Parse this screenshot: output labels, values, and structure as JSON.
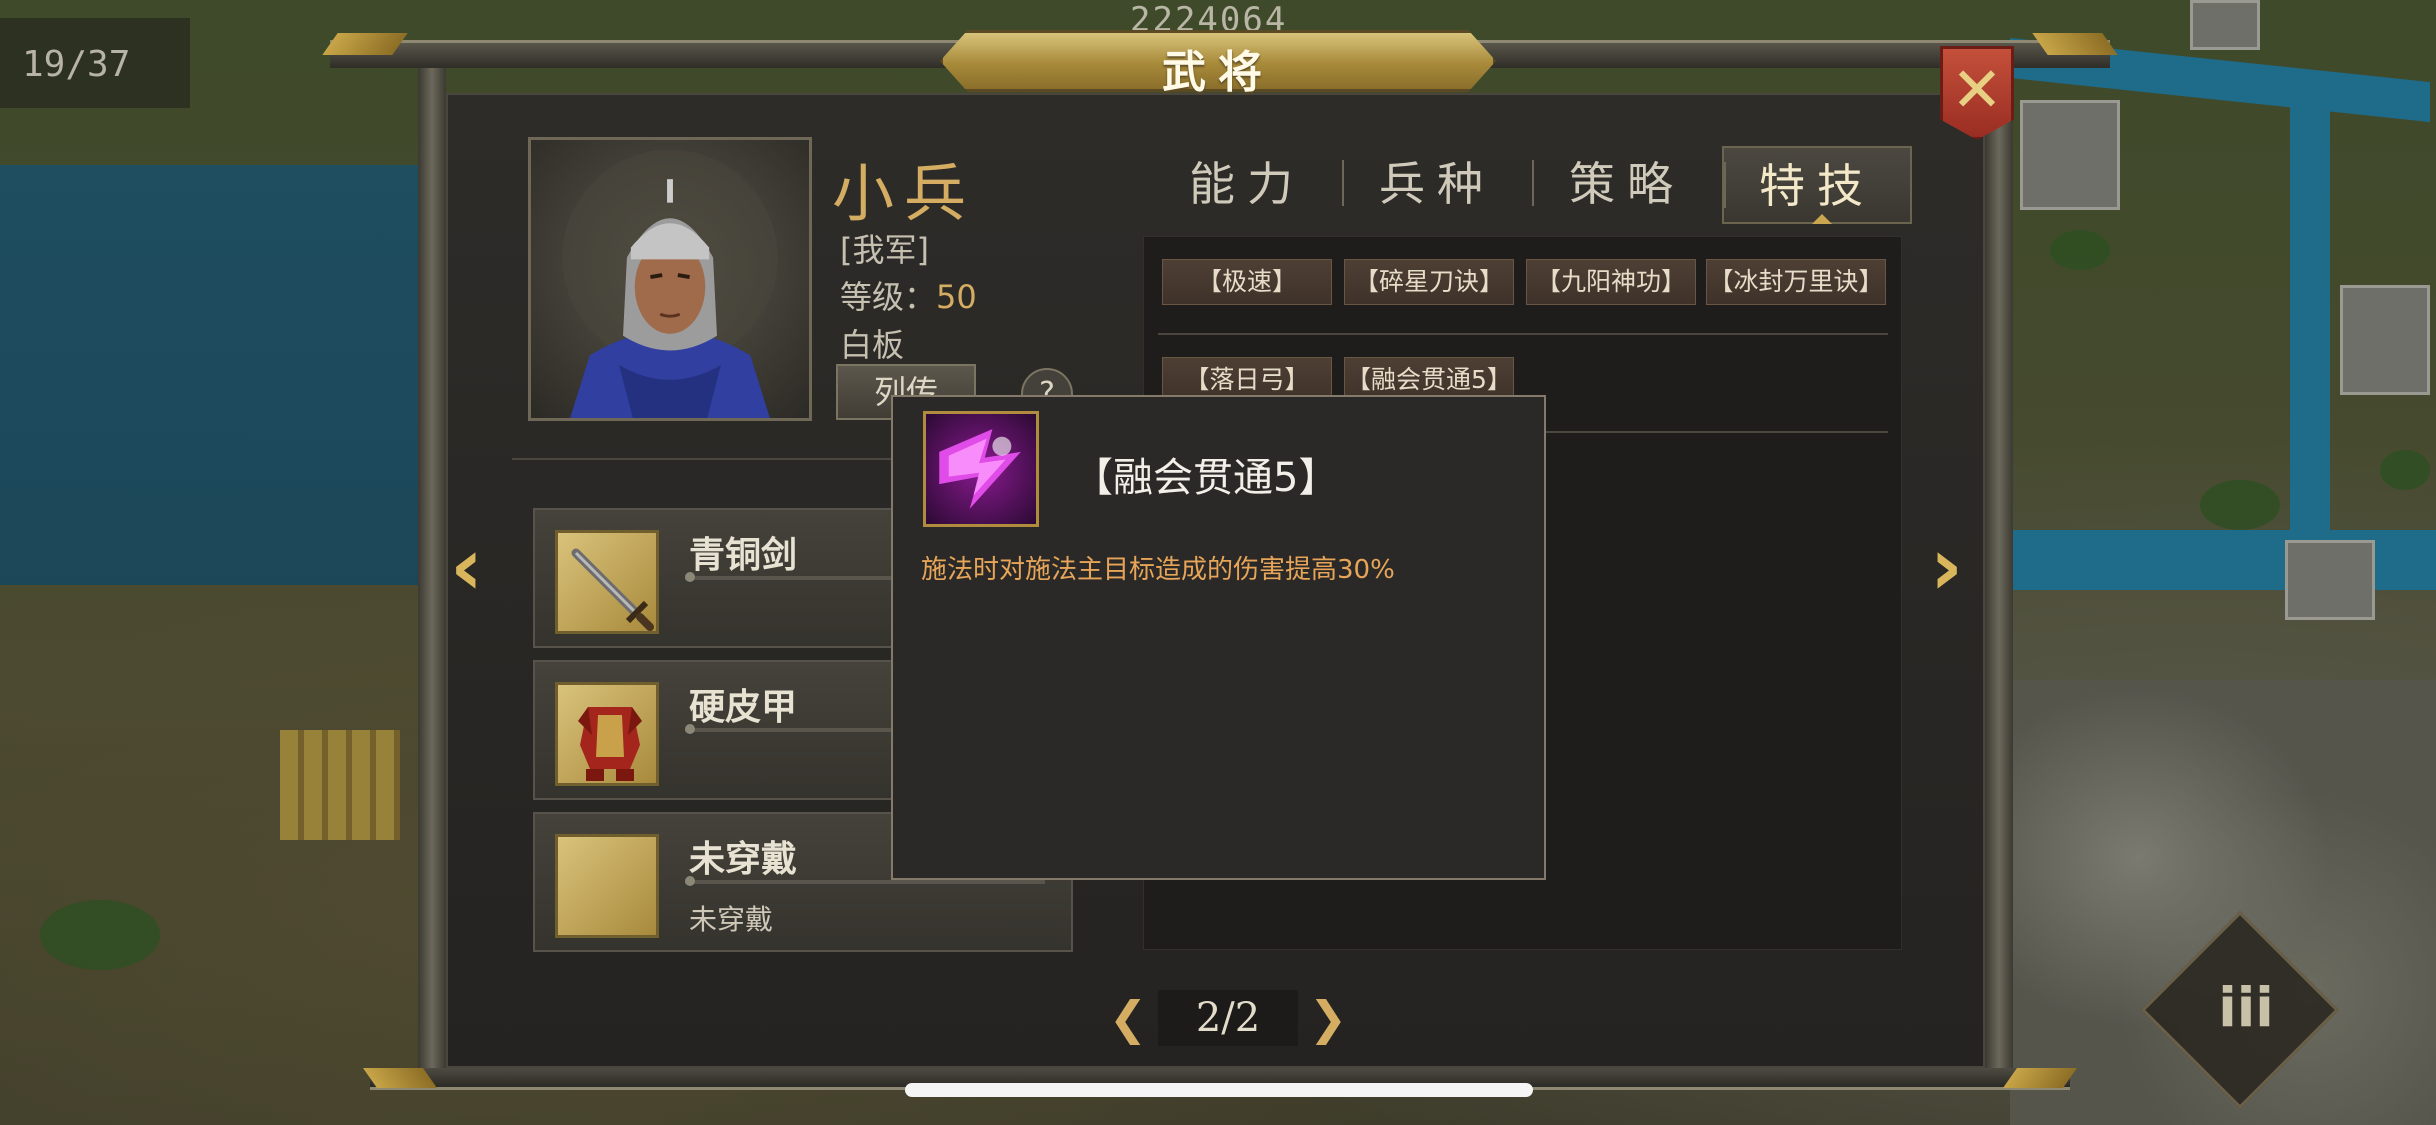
{
  "hud": {
    "page_count": "19/37",
    "top_counter": "2224064",
    "menu_glyph": "iii"
  },
  "window": {
    "title": "武将",
    "close_glyph": "✕"
  },
  "general": {
    "name": "小兵",
    "faction": "[我军]",
    "level_label": "等级：",
    "level_value": "50",
    "note": "白板",
    "bio_button": "列传",
    "help_glyph": "?"
  },
  "tabs": [
    {
      "label": "能力",
      "active": false
    },
    {
      "label": "兵种",
      "active": false
    },
    {
      "label": "策略",
      "active": false
    },
    {
      "label": "特技",
      "active": true
    }
  ],
  "skills_row1": [
    "【极速】",
    "【碎星刀诀】",
    "【九阳神功】",
    "【冰封万里诀】"
  ],
  "skills_row2": [
    "【落日弓】",
    "【融会贯通5】"
  ],
  "equipment": [
    {
      "name": "青铜剑",
      "sub": "",
      "icon": "sword-icon"
    },
    {
      "name": "硬皮甲",
      "sub": "",
      "icon": "armor-icon"
    },
    {
      "name": "未穿戴",
      "sub": "未穿戴",
      "icon": "empty-slot"
    }
  ],
  "nav": {
    "prev": "‹",
    "next": "›",
    "page": "2/2",
    "page_prev": "❮",
    "page_next": "❯"
  },
  "tooltip": {
    "title": "【融会贯通5】",
    "description": "施法时对施法主目标造成的伤害提高30%",
    "icon": "skill-crystal-icon"
  },
  "colors": {
    "accent_gold": "#d4ad62",
    "desc_orange": "#e6a558",
    "close_red": "#b03f2e"
  }
}
